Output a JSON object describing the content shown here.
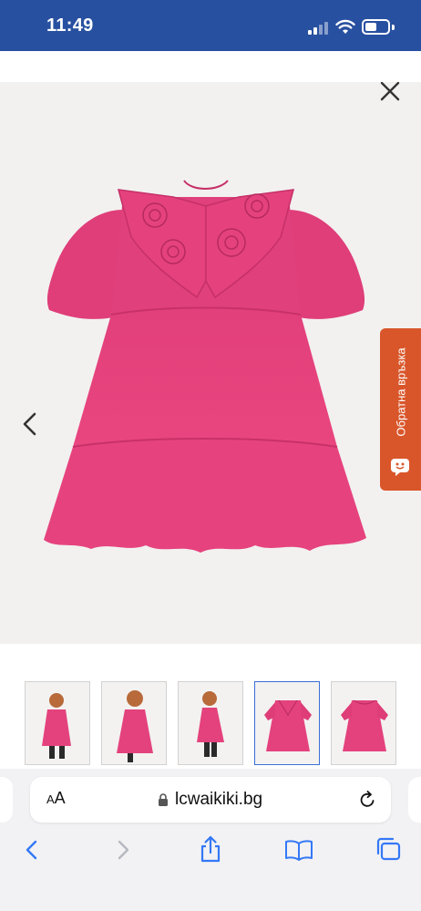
{
  "status_bar": {
    "time": "11:49",
    "background": "#2850a0",
    "signal_icon": "cellular-signal-icon",
    "wifi_icon": "wifi-icon",
    "battery_icon": "battery-icon"
  },
  "gallery": {
    "background": "#f2f1f0",
    "product_color": "#e8417f",
    "close_icon": "close-icon",
    "prev_icon": "chevron-left-icon",
    "thumbnails": [
      {
        "type": "child-model-front"
      },
      {
        "type": "child-model-side"
      },
      {
        "type": "child-model-profile"
      },
      {
        "type": "dress-front",
        "selected": true
      },
      {
        "type": "dress-back"
      }
    ]
  },
  "feedback": {
    "label": "Обратна връзка",
    "background": "#d9562a",
    "icon": "chat-face-icon"
  },
  "safari": {
    "text_size_label_small": "A",
    "text_size_label_large": "A",
    "url": "lcwaikiki.bg",
    "lock_icon": "lock-icon",
    "reload_icon": "reload-icon",
    "toolbar": [
      "back-icon",
      "forward-icon",
      "share-icon",
      "bookmarks-icon",
      "tabs-icon"
    ]
  }
}
